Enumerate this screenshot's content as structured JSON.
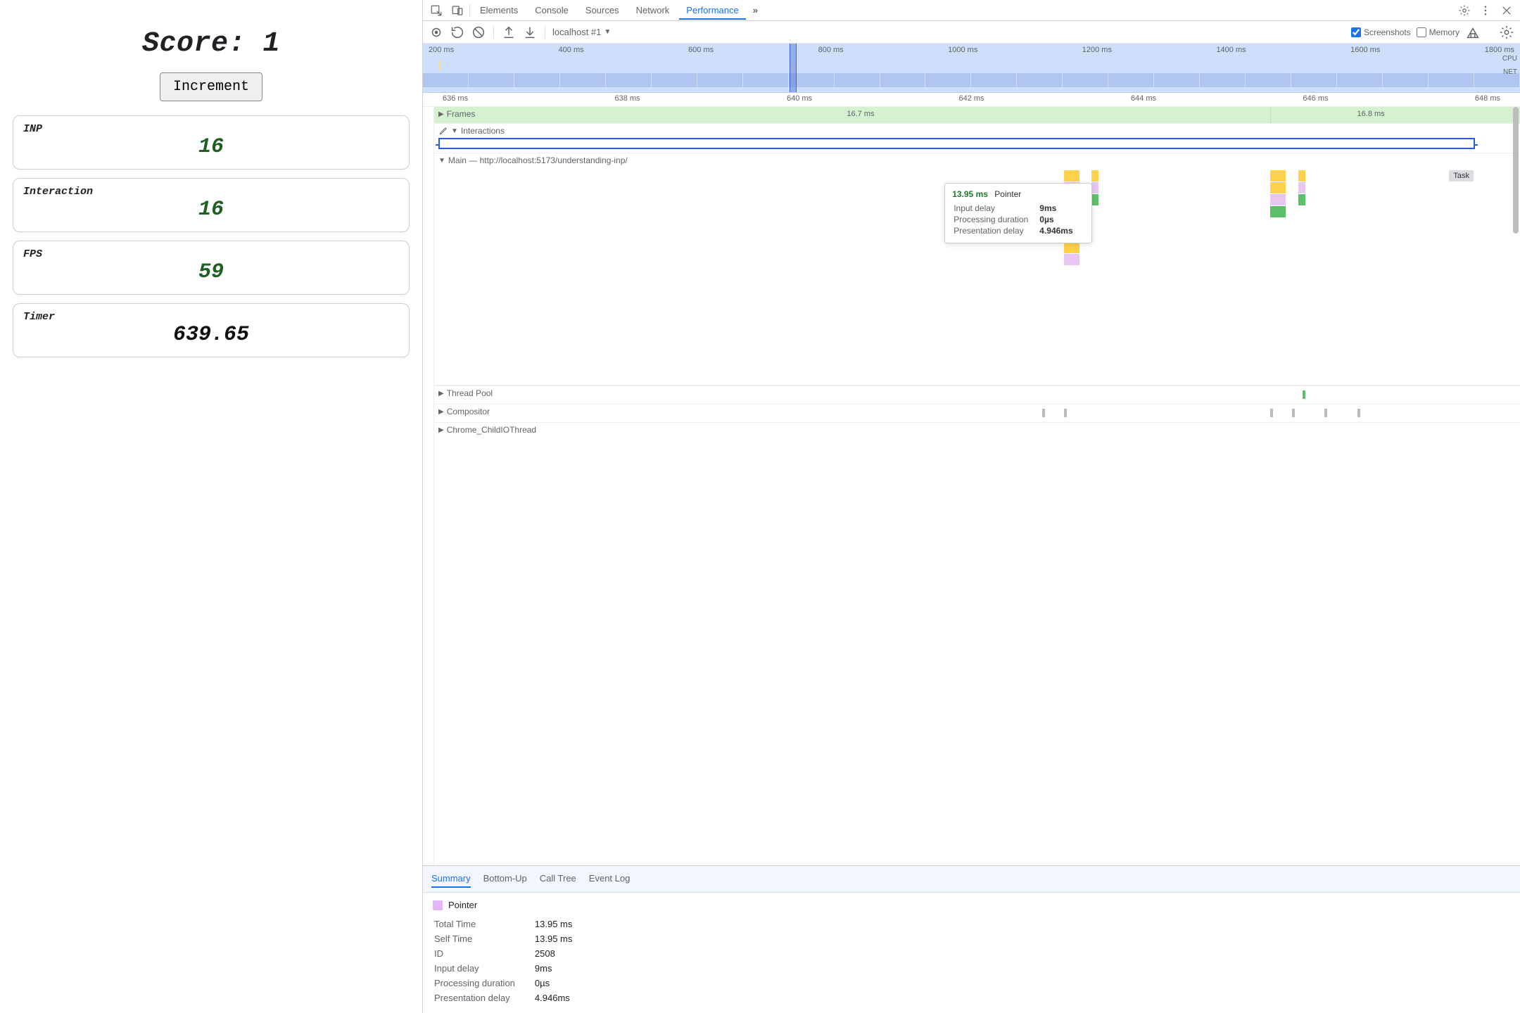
{
  "app": {
    "title": "Score:  1",
    "increment_label": "Increment",
    "metrics": {
      "inp": {
        "label": "INP",
        "value": "16"
      },
      "interaction": {
        "label": "Interaction",
        "value": "16"
      },
      "fps": {
        "label": "FPS",
        "value": "59"
      },
      "timer": {
        "label": "Timer",
        "value": "639.65"
      }
    }
  },
  "devtools": {
    "tabs": {
      "elements": "Elements",
      "console": "Console",
      "sources": "Sources",
      "network": "Network",
      "performance": "Performance",
      "overflow": "»"
    },
    "toolbar": {
      "recording_source": "localhost #1",
      "screenshots_label": "Screenshots",
      "memory_label": "Memory",
      "screenshots_checked": true,
      "memory_checked": false
    },
    "overview": {
      "ticks": [
        "200 ms",
        "400 ms",
        "600 ms",
        "800 ms",
        "1000 ms",
        "1200 ms",
        "1400 ms",
        "1600 ms",
        "1800 ms"
      ],
      "cpu_label": "CPU",
      "net_label": "NET"
    },
    "zoom": {
      "ticks": [
        "636 ms",
        "638 ms",
        "640 ms",
        "642 ms",
        "644 ms",
        "646 ms",
        "648 ms"
      ]
    },
    "tracks": {
      "frames_label": "Frames",
      "frame_times": {
        "a": "16.7 ms",
        "b": "16.8 ms"
      },
      "interactions_label": "Interactions",
      "main_label": "Main — http://localhost:5173/understanding-inp/",
      "task_label": "Task",
      "thread_pool_label": "Thread Pool",
      "compositor_label": "Compositor",
      "childio_label": "Chrome_ChildIOThread"
    },
    "tooltip": {
      "ms": "13.95 ms",
      "name": "Pointer",
      "rows": {
        "input_delay_label": "Input delay",
        "input_delay_value": "9ms",
        "processing_label": "Processing duration",
        "processing_value": "0µs",
        "presentation_label": "Presentation delay",
        "presentation_value": "4.946ms"
      }
    },
    "detail_tabs": {
      "summary": "Summary",
      "bottom_up": "Bottom-Up",
      "call_tree": "Call Tree",
      "event_log": "Event Log"
    },
    "summary": {
      "event_name": "Pointer",
      "rows": {
        "total_time_label": "Total Time",
        "total_time_value": "13.95 ms",
        "self_time_label": "Self Time",
        "self_time_value": "13.95 ms",
        "id_label": "ID",
        "id_value": "2508",
        "input_delay_label": "Input delay",
        "input_delay_value": "9ms",
        "processing_label": "Processing duration",
        "processing_value": "0µs",
        "presentation_label": "Presentation delay",
        "presentation_value": "4.946ms"
      }
    }
  }
}
